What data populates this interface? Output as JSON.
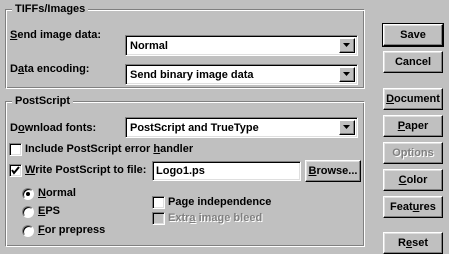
{
  "tiffs_group": {
    "title": "TIFFs/Images",
    "send_image_data": {
      "label_pre": "",
      "label_key": "S",
      "label_post": "end image data:",
      "value": "Normal"
    },
    "data_encoding": {
      "label_pre": "D",
      "label_key": "a",
      "label_post": "ta encoding:",
      "value": "Send binary image data"
    }
  },
  "postscript_group": {
    "title": "PostScript",
    "download_fonts": {
      "label_pre": "D",
      "label_key": "o",
      "label_post": "wnload fonts:",
      "value": "PostScript and TrueType"
    },
    "include_error_handler": {
      "label_pre": "Include PostScript error ",
      "label_key": "h",
      "label_post": "andler",
      "checked": false
    },
    "write_to_file": {
      "label_pre": "",
      "label_key": "W",
      "label_post": "rite PostScript to file:",
      "checked": true,
      "value": "Logo1.ps"
    },
    "browse": {
      "label_pre": "",
      "label_key": "B",
      "label_post": "rowse..."
    },
    "radios": [
      {
        "key": "N",
        "post": "ormal",
        "selected": true
      },
      {
        "key": "E",
        "post": "PS",
        "selected": false
      },
      {
        "key": "F",
        "post": "or prepress",
        "selected": false
      }
    ],
    "page_independence": {
      "label_pre": "Pa",
      "label_key": "g",
      "label_post": "e independence",
      "checked": false
    },
    "extra_image_bleed": {
      "label_pre": "Extr",
      "label_key": "a",
      "label_post": " image bleed",
      "checked": false,
      "disabled": true
    }
  },
  "buttons": {
    "save": "Save",
    "cancel": "Cancel",
    "document": {
      "key": "D",
      "post": "ocument"
    },
    "paper": {
      "key": "P",
      "post": "aper"
    },
    "options": "Options",
    "color": {
      "key": "C",
      "post": "olor"
    },
    "features": {
      "pre": "Feat",
      "key": "u",
      "post": "res"
    },
    "reset": {
      "pre": "R",
      "key": "e",
      "post": "set"
    }
  }
}
